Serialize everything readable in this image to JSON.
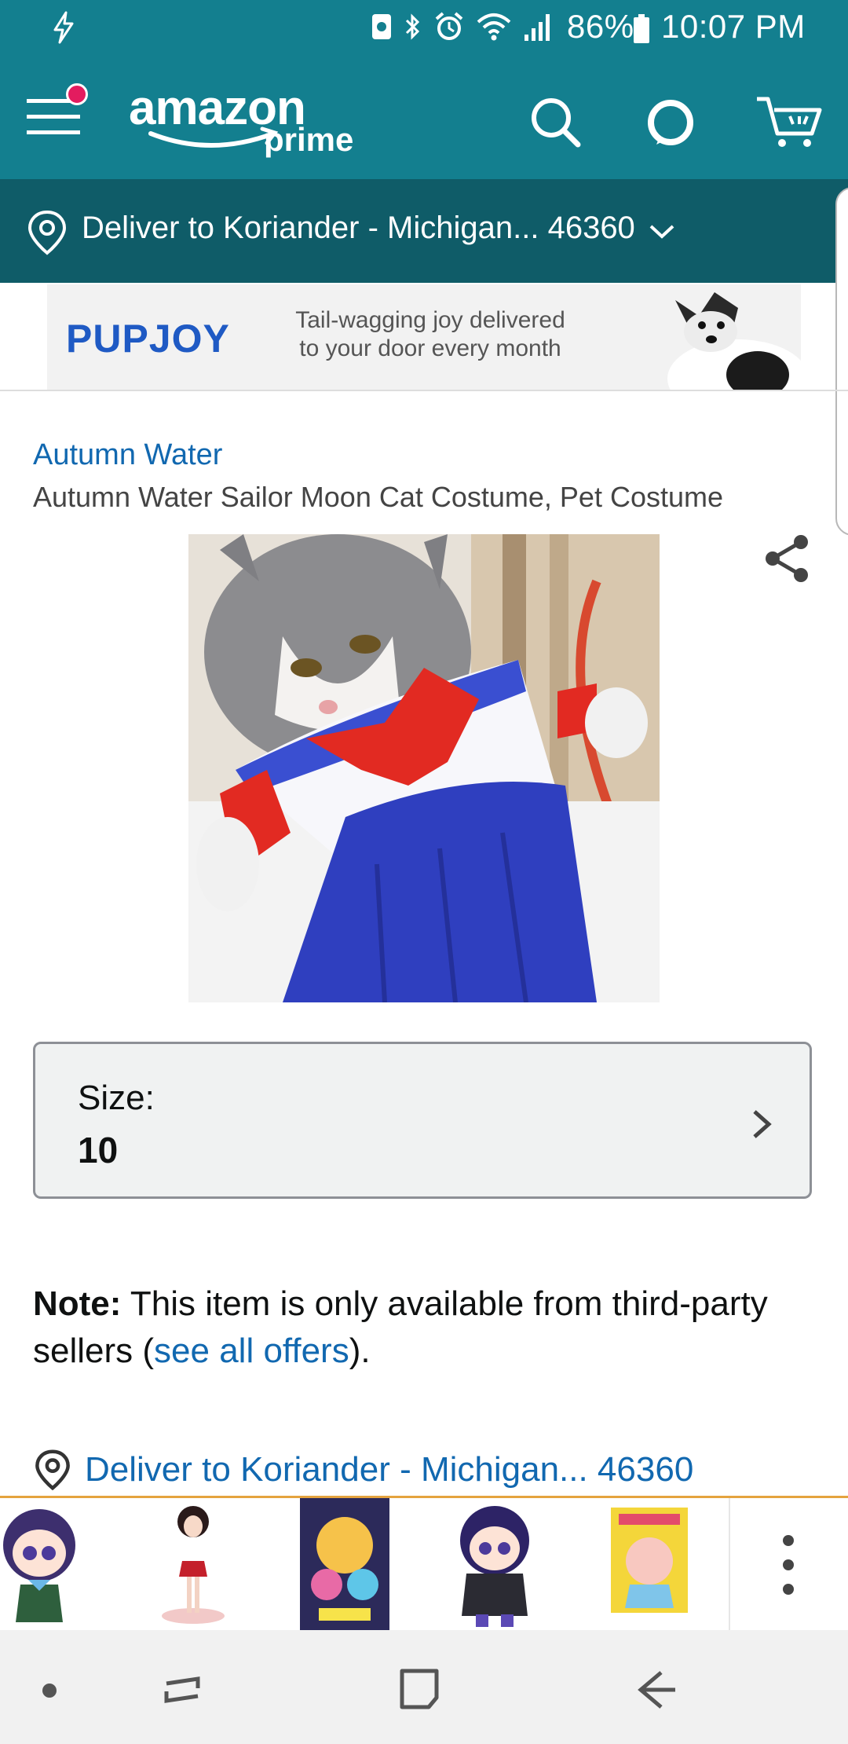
{
  "status_bar": {
    "battery_percent": "86%",
    "time": "10:07 PM",
    "icons": [
      "charging-bolt-icon",
      "nfc-icon",
      "bluetooth-icon",
      "alarm-icon",
      "wifi-icon",
      "signal-icon",
      "battery-icon"
    ]
  },
  "header": {
    "logo_word": "amazon",
    "logo_sub": "prime",
    "menu_badge_color": "#e31c5f",
    "bar_color": "#137f8f"
  },
  "delivery": {
    "label": "Deliver to Koriander - Michigan... 46360"
  },
  "ad": {
    "brand": "PUPJOY",
    "tagline_line1": "Tail-wagging joy delivered",
    "tagline_line2": "to your door every month"
  },
  "product": {
    "brand": "Autumn Water",
    "title": "Autumn Water Sailor Moon Cat Costume, Pet Costume"
  },
  "size": {
    "label": "Size:",
    "value": "10"
  },
  "note": {
    "bold": "Note:",
    "text": " This item is only available from third-party sellers (",
    "link": "see all offers",
    "end": ")."
  },
  "delivery_link": {
    "label": "Deliver to Koriander - Michigan... 46360"
  },
  "related": {
    "thumbs": [
      "hotaru-plush-doll",
      "sailor-mars-figure",
      "sailor-moon-poster",
      "sailor-saturn-plush",
      "sailor-moon-manga-cover"
    ],
    "more_icon": "more-vertical-icon"
  },
  "colors": {
    "link": "#1168b0",
    "deliver_bar": "#0f5c68",
    "strip_accent": "#e4a33e"
  }
}
